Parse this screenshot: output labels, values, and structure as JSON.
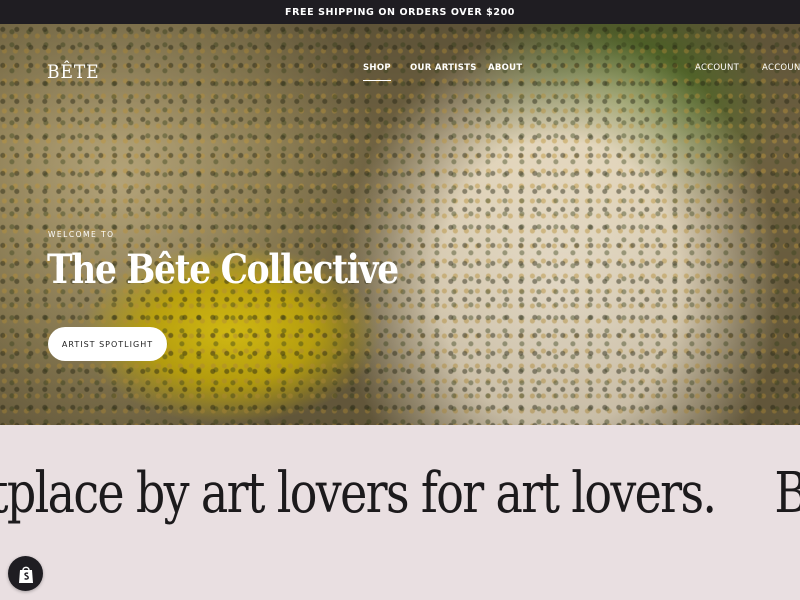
{
  "announcement": {
    "text": "FREE SHIPPING ON ORDERS OVER $200"
  },
  "header": {
    "logo": "BÊTE",
    "nav": {
      "shop": "SHOP",
      "artists": "OUR ARTISTS",
      "about": "ABOUT",
      "account_1": "ACCOUNT",
      "account_2": "ACCOUNT"
    }
  },
  "hero": {
    "eyebrow": "WELCOME TO",
    "title": "The Bête Collective",
    "cta_label": "ARTIST SPOTLIGHT"
  },
  "marquee": {
    "segment_1": "tplace by art lovers for art lovers.",
    "segment_2": "Bête is"
  },
  "badge": {
    "icon": "shopify-bag-icon"
  },
  "colors": {
    "announcement_bg": "#1f1d22",
    "marquee_bg": "#e9dfe1",
    "text_dark": "#1c1a1c",
    "white": "#ffffff"
  }
}
